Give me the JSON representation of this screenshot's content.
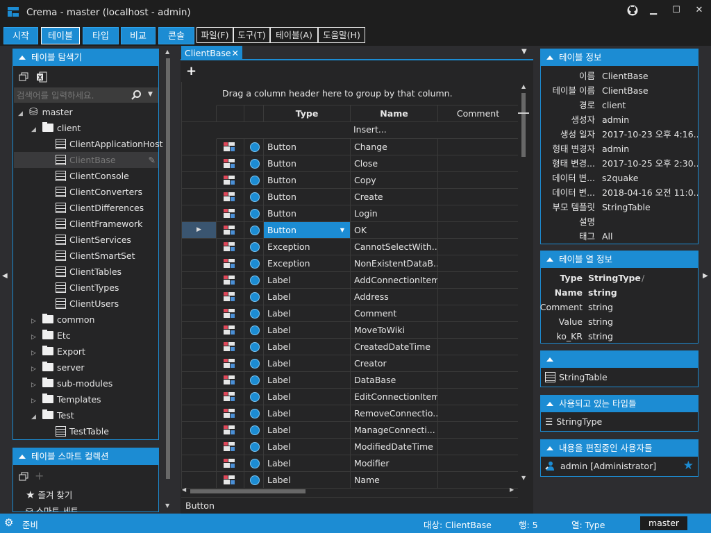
{
  "window": {
    "title": "Crema - master (localhost - admin)",
    "controls": [
      "github",
      "minimize",
      "maximize",
      "close"
    ]
  },
  "tabs": [
    {
      "label": "시작"
    },
    {
      "label": "테이블"
    },
    {
      "label": "타입"
    },
    {
      "label": "비교"
    },
    {
      "label": "콘솔"
    }
  ],
  "menus": [
    {
      "label": "파일(F)"
    },
    {
      "label": "도구(T)"
    },
    {
      "label": "테이블(A)"
    },
    {
      "label": "도움말(H)"
    }
  ],
  "explorer": {
    "title": "테이블 탐색기",
    "search_placeholder": "검색어를 입력하세요.",
    "tree": [
      {
        "label": "master",
        "level": 0,
        "kind": "db",
        "expanded": true
      },
      {
        "label": "client",
        "level": 1,
        "kind": "folder",
        "expanded": true
      },
      {
        "label": "ClientApplicationHost",
        "level": 2,
        "kind": "table"
      },
      {
        "label": "ClientBase",
        "level": 2,
        "kind": "table",
        "selected": true
      },
      {
        "label": "ClientConsole",
        "level": 2,
        "kind": "table"
      },
      {
        "label": "ClientConverters",
        "level": 2,
        "kind": "table"
      },
      {
        "label": "ClientDifferences",
        "level": 2,
        "kind": "table"
      },
      {
        "label": "ClientFramework",
        "level": 2,
        "kind": "table"
      },
      {
        "label": "ClientServices",
        "level": 2,
        "kind": "table"
      },
      {
        "label": "ClientSmartSet",
        "level": 2,
        "kind": "table"
      },
      {
        "label": "ClientTables",
        "level": 2,
        "kind": "table"
      },
      {
        "label": "ClientTypes",
        "level": 2,
        "kind": "table"
      },
      {
        "label": "ClientUsers",
        "level": 2,
        "kind": "table"
      },
      {
        "label": "common",
        "level": 1,
        "kind": "folder",
        "expanded": false
      },
      {
        "label": "Etc",
        "level": 1,
        "kind": "folder",
        "expanded": false
      },
      {
        "label": "Export",
        "level": 1,
        "kind": "folder",
        "expanded": false
      },
      {
        "label": "server",
        "level": 1,
        "kind": "folder",
        "expanded": false
      },
      {
        "label": "sub-modules",
        "level": 1,
        "kind": "folder",
        "expanded": false
      },
      {
        "label": "Templates",
        "level": 1,
        "kind": "folder",
        "expanded": false
      },
      {
        "label": "Test",
        "level": 1,
        "kind": "folder",
        "expanded": true
      },
      {
        "label": "TestTable",
        "level": 2,
        "kind": "table"
      }
    ]
  },
  "smart": {
    "title": "테이블 스마트 컬렉션",
    "items": [
      {
        "label": "즐겨 찾기",
        "icon": "star-icon"
      },
      {
        "label": "스마트 세트",
        "icon": "database-icon"
      }
    ]
  },
  "doc": {
    "tab": "ClientBase",
    "group_hint": "Drag a column header here to group by that column.",
    "columns": [
      "Type",
      "Name",
      "Comment"
    ],
    "insert": "Insert...",
    "rows": [
      {
        "type": "Button",
        "name": "Change"
      },
      {
        "type": "Button",
        "name": "Close"
      },
      {
        "type": "Button",
        "name": "Copy"
      },
      {
        "type": "Button",
        "name": "Create"
      },
      {
        "type": "Button",
        "name": "Login"
      },
      {
        "type": "Button",
        "name": "OK",
        "current": true
      },
      {
        "type": "Exception",
        "name": "CannotSelectWith..."
      },
      {
        "type": "Exception",
        "name": "NonExistentDataB..."
      },
      {
        "type": "Label",
        "name": "AddConnectionItem"
      },
      {
        "type": "Label",
        "name": "Address"
      },
      {
        "type": "Label",
        "name": "Comment"
      },
      {
        "type": "Label",
        "name": "MoveToWiki"
      },
      {
        "type": "Label",
        "name": "CreatedDateTime"
      },
      {
        "type": "Label",
        "name": "Creator"
      },
      {
        "type": "Label",
        "name": "DataBase"
      },
      {
        "type": "Label",
        "name": "EditConnectionItem"
      },
      {
        "type": "Label",
        "name": "RemoveConnectio..."
      },
      {
        "type": "Label",
        "name": "ManageConnecti..."
      },
      {
        "type": "Label",
        "name": "ModifiedDateTime"
      },
      {
        "type": "Label",
        "name": "Modifier"
      },
      {
        "type": "Label",
        "name": "Name"
      }
    ],
    "footer": "Button"
  },
  "info": {
    "title": "테이블 정보",
    "rows": [
      {
        "k": "이름",
        "v": "ClientBase"
      },
      {
        "k": "테이블 이름",
        "v": "ClientBase"
      },
      {
        "k": "경로",
        "v": "client"
      },
      {
        "k": "생성자",
        "v": "admin"
      },
      {
        "k": "생성 일자",
        "v": "2017-10-23 오후 4:16..."
      },
      {
        "k": "형태 변경자",
        "v": "admin"
      },
      {
        "k": "형태 변경...",
        "v": "2017-10-25 오후 2:30..."
      },
      {
        "k": "데이터 변...",
        "v": "s2quake"
      },
      {
        "k": "데이터 변...",
        "v": "2018-04-16 오전 11:0..."
      },
      {
        "k": "부모 템플릿",
        "v": "StringTable"
      },
      {
        "k": "설명",
        "v": ""
      },
      {
        "k": "태그",
        "v": "All"
      }
    ]
  },
  "colinfo": {
    "title": "테이블 열 정보",
    "rows": [
      {
        "k": "Type",
        "v": "StringType",
        "bold": true,
        "extra": "/"
      },
      {
        "k": "Name",
        "v": "string",
        "bold": true
      },
      {
        "k": "Comment",
        "v": "string"
      },
      {
        "k": "Value",
        "v": "string"
      },
      {
        "k": "ko_KR",
        "v": "string"
      }
    ]
  },
  "parent": {
    "title": "",
    "item": "StringTable"
  },
  "used_types": {
    "title": "사용되고 있는 타입들",
    "item": "StringType"
  },
  "editors": {
    "title": "내용을 편집중인 사용자들",
    "item": "admin [Administrator]"
  },
  "status": {
    "ready": "준비",
    "target": "대상: ClientBase",
    "row": "행: 5",
    "col": "열: Type",
    "branch": "master"
  }
}
